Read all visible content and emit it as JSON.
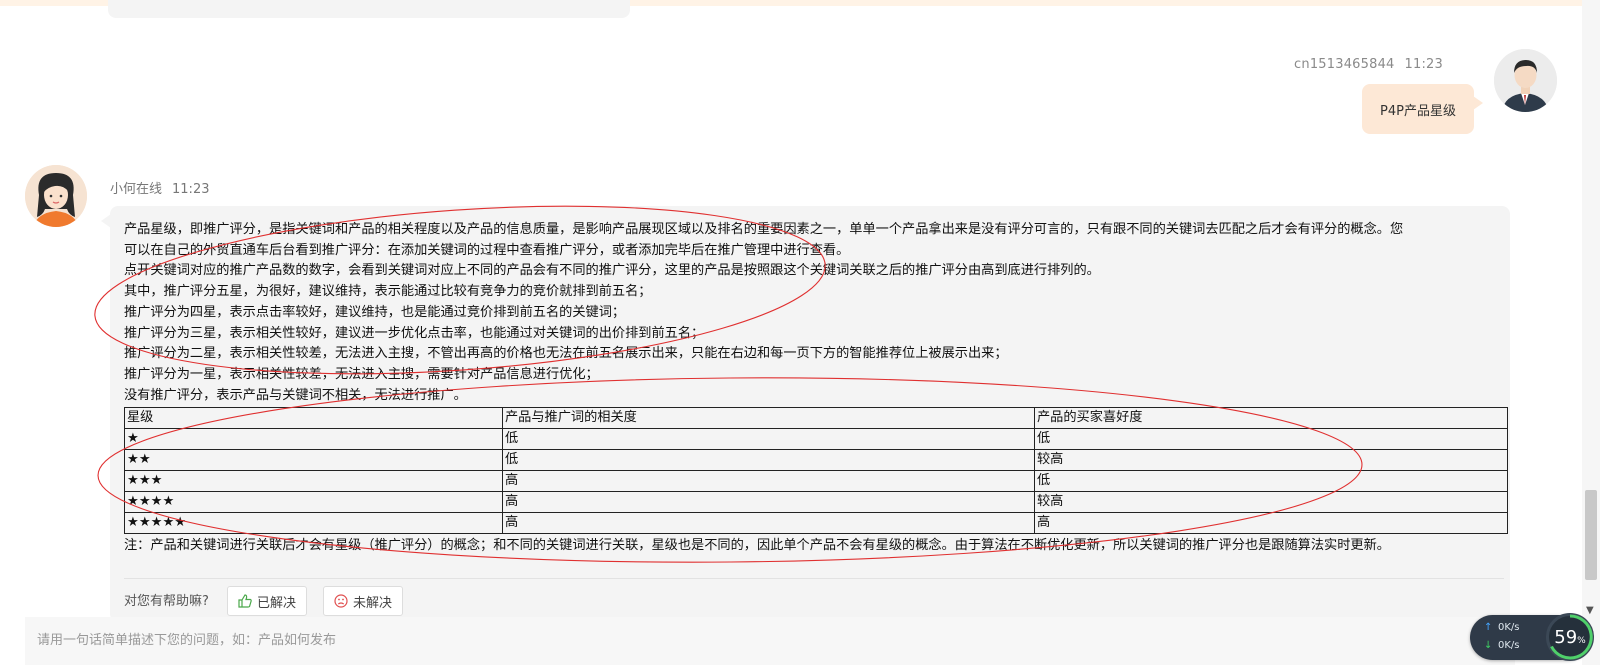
{
  "user_message": {
    "username": "cn1513465844",
    "time": "11:23",
    "text": "P4P产品星级"
  },
  "agent_message": {
    "name": "小何在线",
    "time": "11:23",
    "lines": [
      "产品星级，即推广评分，是指关键词和产品的相关程度以及产品的信息质量，是影响产品展现区域以及排名的重要因素之一，单单一个产品拿出来是没有评分可言的，只有跟不同的关键词去匹配之后才会有评分的概念。您",
      "可以在自己的外贸直通车后台看到推广评分：在添加关键词的过程中查看推广评分，或者添加完毕后在推广管理中进行查看。",
      "点开关键词对应的推广产品数的数字，会看到关键词对应上不同的产品会有不同的推广评分，这里的产品是按照跟这个关键词关联之后的推广评分由高到底进行排列的。",
      "其中，推广评分五星，为很好，建议维持，表示能通过比较有竞争力的竞价就排到前五名；",
      "推广评分为四星，表示点击率较好，建议维持，也是能通过竞价排到前五名的关键词；",
      "推广评分为三星，表示相关性较好，建议进一步优化点击率，也能通过对关键词的出价排到前五名；",
      "推广评分为二星，表示相关性较差，无法进入主搜，不管出再高的价格也无法在前五名展示出来，只能在右边和每一页下方的智能推荐位上被展示出来；",
      "推广评分为一星，表示相关性较差，无法进入主搜，需要针对产品信息进行优化；",
      "没有推广评分，表示产品与关键词不相关，无法进行推广。"
    ],
    "table": {
      "headers": [
        "星级",
        "产品与推广词的相关度",
        "产品的买家喜好度"
      ],
      "rows": [
        [
          "★",
          "低",
          "低"
        ],
        [
          "★★",
          "低",
          "较高"
        ],
        [
          "★★★",
          "高",
          "低"
        ],
        [
          "★★★★",
          "高",
          "较高"
        ],
        [
          "★★★★★",
          "高",
          "高"
        ]
      ]
    },
    "note": "注：产品和关键词进行关联后才会有星级（推广评分）的概念；和不同的关键词进行关联，星级也是不同的，因此单个产品不会有星级的概念。由于算法在不断优化更新，所以关键词的推广评分也是跟随算法实时更新。",
    "feedback": {
      "question": "对您有帮助嘛?",
      "solved_label": "已解决",
      "unsolved_label": "未解决"
    }
  },
  "input": {
    "placeholder": "请用一句话简单描述下您的问题，如：产品如何发布"
  },
  "net_widget": {
    "up_speed": "0K/s",
    "down_speed": "0K/s",
    "percent": "59",
    "percent_unit": "%"
  },
  "colors": {
    "user_bubble": "#fde8d6",
    "agent_bubble": "#f4f4f4",
    "annotation_red": "#e03030"
  }
}
